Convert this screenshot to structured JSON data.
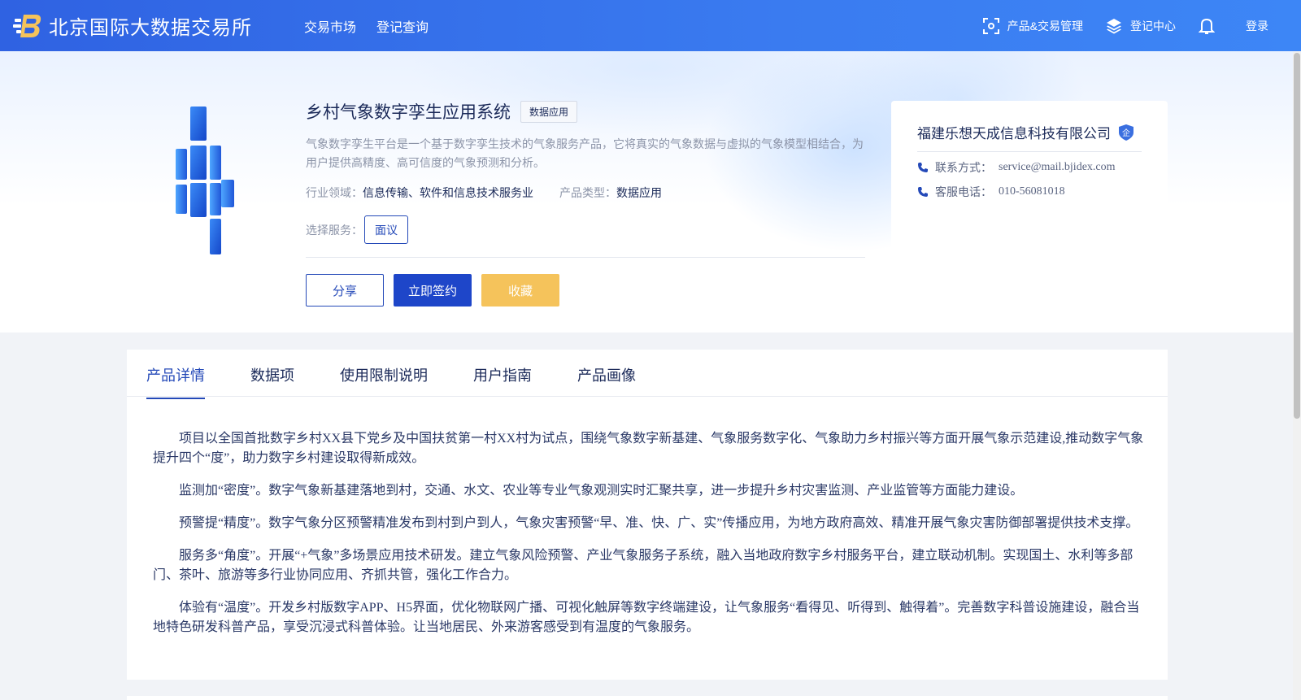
{
  "header": {
    "site_name": "北京国际大数据交易所",
    "nav": [
      "交易市场",
      "登记查询"
    ],
    "product_mgmt": "产品&交易管理",
    "register_center": "登记中心",
    "login": "登录"
  },
  "product": {
    "title": "乡村气象数字孪生应用系统",
    "tag": "数据应用",
    "description": "气象数字孪生平台是一个基于数字孪生技术的气象服务产品，它将真实的气象数据与虚拟的气象模型相结合，为用户提供高精度、高可信度的气象预测和分析。",
    "industry_label": "行业领域：",
    "industry_value": "信息传输、软件和信息技术服务业",
    "type_label": "产品类型：",
    "type_value": "数据应用",
    "service_label": "选择服务：",
    "service_option": "面议",
    "share_label": "分享",
    "sign_label": "立即签约",
    "favorite_label": "收藏"
  },
  "company": {
    "name": "福建乐想天成信息科技有限公司",
    "badge": "企",
    "contact_label": "联系方式：",
    "contact_value": "service@mail.bjidex.com",
    "phone_label": "客服电话：",
    "phone_value": "010-56081018"
  },
  "tabs": [
    "产品详情",
    "数据项",
    "使用限制说明",
    "用户指南",
    "产品画像"
  ],
  "active_tab": "产品详情",
  "article": [
    "项目以全国首批数字乡村XX县下党乡及中国扶贫第一村XX村为试点，围绕气象数字新基建、气象服务数字化、气象助力乡村振兴等方面开展气象示范建设,推动数字气象提升四个“度”，助力数字乡村建设取得新成效。",
    "监测加“密度”。数字气象新基建落地到村，交通、水文、农业等专业气象观测实时汇聚共享，进一步提升乡村灾害监测、产业监管等方面能力建设。",
    "预警提“精度”。数字气象分区预警精准发布到村到户到人，气象灾害预警“早、准、快、广、实”传播应用，为地方政府高效、精准开展气象灾害防御部署提供技术支撑。",
    "服务多“角度”。开展“+气象”多场景应用技术研发。建立气象风险预警、产业气象服务子系统，融入当地政府数字乡村服务平台，建立联动机制。实现国土、水利等多部门、茶叶、旅游等多行业协同应用、齐抓共管，强化工作合力。",
    "体验有“温度”。开发乡村版数字APP、H5界面，优化物联网广播、可视化触屏等数字终端建设，让气象服务“看得见、听得到、触得着”。完善数字科普设施建设，融合当地特色研发科普产品，享受沉浸式科普体验。让当地居民、外来游客感受到有温度的气象服务。"
  ],
  "colors": {
    "header_start": "#2f62e2",
    "header_end": "#3d86f6",
    "primary": "#1e46c9",
    "accent": "#f5c35b",
    "text_dark": "#1b2a59"
  }
}
